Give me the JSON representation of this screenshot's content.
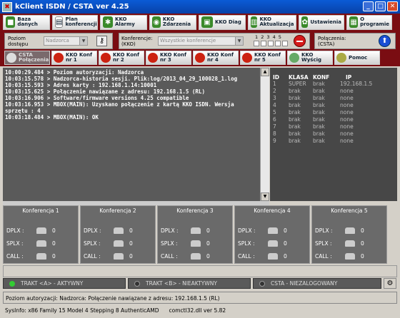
{
  "window": {
    "title": "kClient ISDN / CSTA ver  4.25"
  },
  "toolbar": {
    "buttons": [
      {
        "label": "Baza danych",
        "color": "#3a8a2a"
      },
      {
        "label": "Plan konferencji",
        "color": "#3a8a2a"
      },
      {
        "label": "KKO Alarmy",
        "color": "#3a8a2a"
      },
      {
        "label": "KKO Zdarzenia",
        "color": "#3a8a2a"
      },
      {
        "label": "KKO Diag",
        "color": "#3a8a2a"
      },
      {
        "label": "KKO Aktualizacja",
        "color": "#3a8a2a"
      },
      {
        "label": "Ustawienia",
        "color": "#3a8a2a"
      },
      {
        "label": "O programie",
        "color": "#3a8a2a"
      }
    ]
  },
  "controls": {
    "poziom_label": "Poziom dostępu",
    "poziom_value": "Nadzorca",
    "konferencje_label": "Konferencje: (KKO)",
    "konferencje_value": "Wszystkie konferencje",
    "numbers": "1 2 3 4 5",
    "polaczenia_label": "Połączenia: (CSTA)"
  },
  "tabs": [
    {
      "label": "CSTA Połączenia"
    },
    {
      "label": "KKO Konf nr 1"
    },
    {
      "label": "KKO Konf nr 2"
    },
    {
      "label": "KKO Konf nr 3"
    },
    {
      "label": "KKO Konf nr 4"
    },
    {
      "label": "KKO Konf nr 5"
    },
    {
      "label": "KKO Wyścig"
    },
    {
      "label": "Pomoc"
    }
  ],
  "log": [
    "10:00:29.484 > Poziom autoryzacji: Nadzorca",
    "10:03:15.578 > Nadzorca-historia sesji. Plik:log/2013_04_29_100028_1.log",
    "10:03:15.593 > Adres karty : 192.168.1.14:10001",
    "10:03:15.625 > Połączenie nawiązane z adresu: 192.168.1.5 (RL)",
    "10:03:16.906 > Software/firmware versions 4.25 compatible",
    "10:03:16.953 > MBOX(MAIN): Uzyskano połączenie z kartą KKO ISDN. Wersja sprzętu : 4",
    "10:03:18.484 > MBOX(MAIN): OK"
  ],
  "id_table": {
    "headers": [
      "ID",
      "KLASA",
      "KONF",
      "IP"
    ],
    "rows": [
      [
        "1",
        "SUPER",
        "brak",
        "192.168.1.5"
      ],
      [
        "2",
        "brak",
        "brak",
        "none"
      ],
      [
        "3",
        "brak",
        "brak",
        "none"
      ],
      [
        "4",
        "brak",
        "brak",
        "none"
      ],
      [
        "5",
        "brak",
        "brak",
        "none"
      ],
      [
        "6",
        "brak",
        "brak",
        "none"
      ],
      [
        "7",
        "brak",
        "brak",
        "none"
      ],
      [
        "8",
        "brak",
        "brak",
        "none"
      ],
      [
        "9",
        "brak",
        "brak",
        "none"
      ]
    ]
  },
  "conferences": [
    {
      "title": "Konferencja 1",
      "dplx": "0",
      "splx": "0",
      "call": "0"
    },
    {
      "title": "Konferencja 2",
      "dplx": "0",
      "splx": "0",
      "call": "0"
    },
    {
      "title": "Konferencja 3",
      "dplx": "0",
      "splx": "0",
      "call": "0"
    },
    {
      "title": "Konferencja 4",
      "dplx": "0",
      "splx": "0",
      "call": "0"
    },
    {
      "title": "Konferencja 5",
      "dplx": "0",
      "splx": "0",
      "call": "0"
    }
  ],
  "conf_labels": {
    "dplx": "DPLX :",
    "splx": "SPLX :",
    "call": "CALL :"
  },
  "status": {
    "trakt_a": "TRAKT <A> - AKTYWNY",
    "trakt_b": "TRAKT <B> - NIEAKTYWNY",
    "csta": "CSTA - NIEZALOGOWANY",
    "message": "Poziom autoryzacji: Nadzorca: Połączenie nawiązane z adresu: 192.168.1.5 (RL)",
    "sysinfo": "SysInfo: x86 Family 15 Model 4 Stepping 8 AuthenticAMD",
    "dll": "comctl32.dll ver 5.82"
  }
}
